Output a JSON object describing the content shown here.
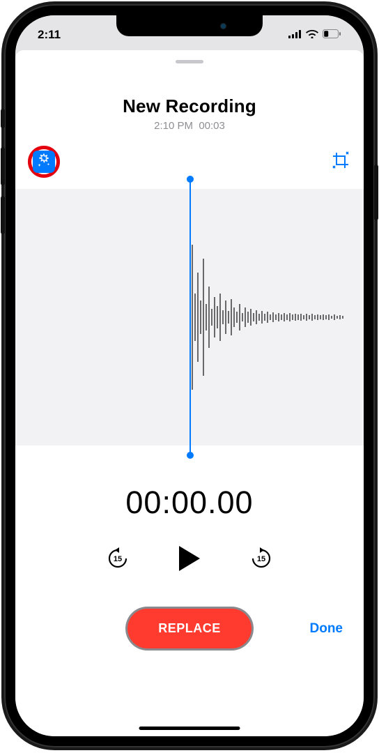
{
  "status_bar": {
    "time": "2:11"
  },
  "recording": {
    "title": "New Recording",
    "timestamp": "2:10 PM",
    "duration": "00:03"
  },
  "icons": {
    "enhance": "enhance-icon",
    "crop": "crop-icon",
    "skip_back": "skip-back-15-icon",
    "play": "play-icon",
    "skip_forward": "skip-forward-15-icon"
  },
  "skip_seconds": "15",
  "playback_time": "00:00.00",
  "actions": {
    "replace_label": "REPLACE",
    "done_label": "Done"
  },
  "colors": {
    "accent": "#007aff",
    "destructive": "#ff3b30",
    "annotation_ring": "#e3000f"
  }
}
